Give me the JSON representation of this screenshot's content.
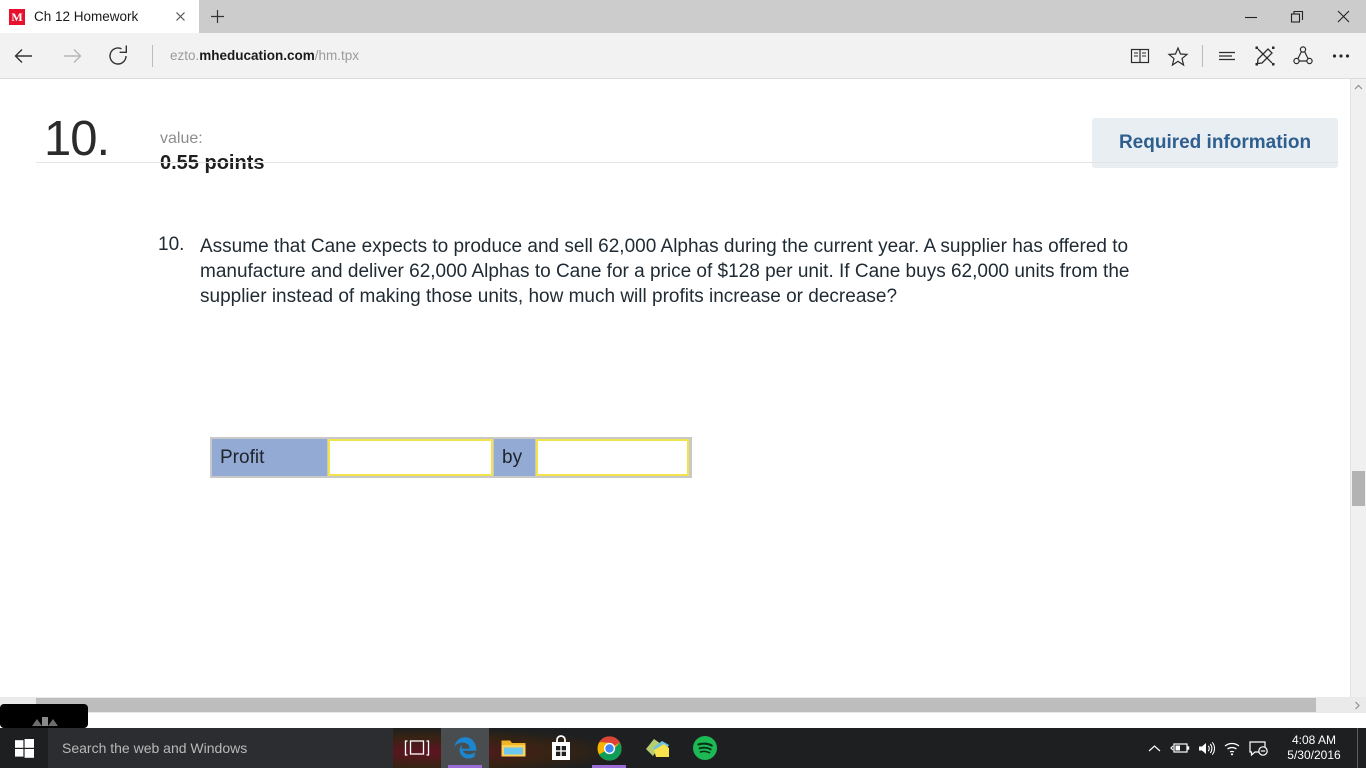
{
  "browser": {
    "tab": {
      "title": "Ch 12 Homework",
      "favicon_letter": "M",
      "favicon_color": "#e8112d",
      "close_icon": "close-icon"
    },
    "new_tab_icon": "plus-icon",
    "window_controls": {
      "minimize": "minimize-icon",
      "restore": "restore-icon",
      "close": "close-icon"
    },
    "nav": {
      "back_icon": "back-arrow-icon",
      "forward_icon": "forward-arrow-icon",
      "refresh_icon": "refresh-icon"
    },
    "url": {
      "prefix": "ezto.",
      "host": "mheducation.com",
      "path": "/hm.tpx"
    },
    "right_icons": [
      {
        "name": "reading-view-icon",
        "label": "Reading view"
      },
      {
        "name": "favorites-star-icon",
        "label": "Add to favorites or reading list"
      },
      {
        "name": "hub-icon",
        "label": "Hub"
      },
      {
        "name": "web-note-icon",
        "label": "Make a Web Note"
      },
      {
        "name": "share-icon",
        "label": "Share"
      },
      {
        "name": "more-icon",
        "label": "More"
      }
    ]
  },
  "question": {
    "big_number": "10.",
    "value_label": "value:",
    "value_points": "0.55 points",
    "required_information": "Required information",
    "list_number": "10.",
    "text": "Assume that Cane expects to produce and sell 62,000 Alphas during the current year. A supplier has offered to manufacture and deliver 62,000 Alphas to Cane for a price of $128 per unit. If Cane buys 62,000 units from the supplier instead of making those units, how much will profits increase or decrease?"
  },
  "answer_table": {
    "label_profit": "Profit",
    "label_by": "by",
    "input_direction_value": "",
    "input_direction_placeholder": "",
    "input_amount_value": "",
    "input_amount_placeholder": "",
    "label_cell_color": "#93aad4",
    "input_border_color": "#f2e34a"
  },
  "scrollbars": {
    "vertical_up_icon": "chevron-up-icon",
    "vertical_down_icon": "chevron-down-icon",
    "horizontal_right_icon": "chevron-right-icon"
  },
  "taskbar": {
    "start_icon": "windows-start-icon",
    "search_placeholder": "Search the web and Windows",
    "task_view_icon": "task-view-icon",
    "apps": [
      {
        "name": "taskbar-app-edge",
        "label": "Microsoft Edge",
        "icon": "edge-icon",
        "active": true
      },
      {
        "name": "taskbar-app-file-explorer",
        "label": "File Explorer",
        "icon": "file-explorer-icon",
        "active": false
      },
      {
        "name": "taskbar-app-store",
        "label": "Store",
        "icon": "store-icon",
        "active": false
      },
      {
        "name": "taskbar-app-chrome",
        "label": "Google Chrome",
        "icon": "chrome-icon",
        "active": true
      },
      {
        "name": "taskbar-app-sticky-notes",
        "label": "Sticky Notes",
        "icon": "sticky-notes-icon",
        "active": false
      },
      {
        "name": "taskbar-app-spotify",
        "label": "Spotify",
        "icon": "spotify-icon",
        "active": false
      }
    ],
    "tray": [
      {
        "name": "tray-show-hidden-icon",
        "icon": "chevron-up-icon"
      },
      {
        "name": "tray-battery-icon",
        "icon": "battery-icon"
      },
      {
        "name": "tray-volume-icon",
        "icon": "speaker-icon"
      },
      {
        "name": "tray-network-icon",
        "icon": "wifi-icon"
      },
      {
        "name": "tray-action-center-icon",
        "icon": "action-center-quiet-icon"
      }
    ],
    "clock": {
      "time": "4:08 AM",
      "date": "5/30/2016"
    }
  }
}
